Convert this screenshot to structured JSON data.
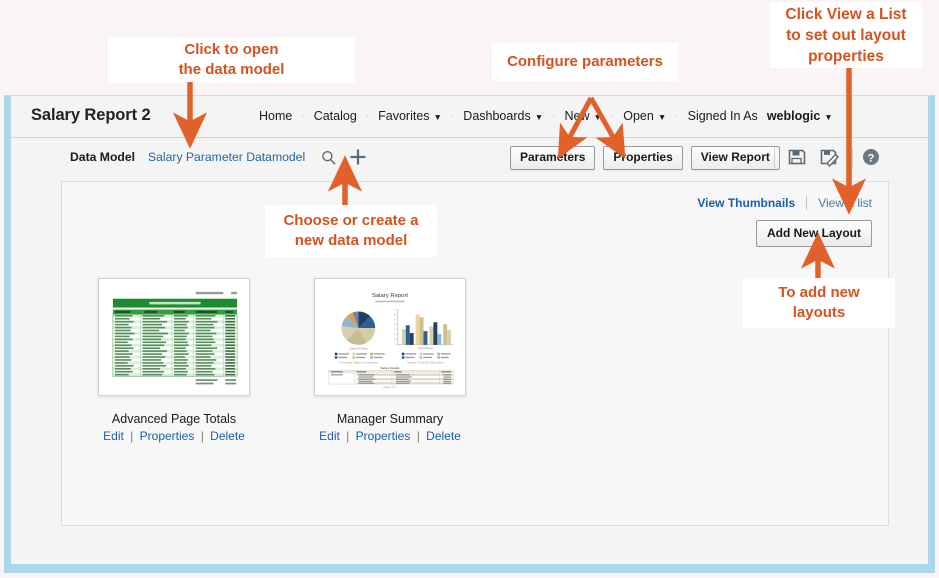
{
  "window": {
    "title": "Salary Report 2",
    "border_color": "#abd7ec",
    "background": "#f4f4f4"
  },
  "globalnav": {
    "items": [
      {
        "label": "Home",
        "caret": false
      },
      {
        "label": "Catalog",
        "caret": false
      },
      {
        "label": "Favorites",
        "caret": true
      },
      {
        "label": "Dashboards",
        "caret": true
      },
      {
        "label": "New",
        "caret": true
      },
      {
        "label": "Open",
        "caret": true
      }
    ],
    "signed_in_label": "Signed In As",
    "user": "weblogic",
    "user_caret": "▼",
    "separator": "·"
  },
  "toolbar": {
    "data_model_label": "Data Model",
    "data_model_value": "Salary Parameter Datamodel",
    "search_icon": "search-icon",
    "add_icon": "plus-icon",
    "buttons": [
      {
        "label": "Parameters",
        "name": "parameters-button"
      },
      {
        "label": "Properties",
        "name": "properties-button"
      },
      {
        "label": "View Report",
        "name": "view-report-button"
      }
    ],
    "save_icon": "save-icon",
    "save_as_icon": "save-as-icon",
    "help_icon": "help-icon"
  },
  "content": {
    "view_thumbnails_label": "View Thumbnails",
    "view_list_label": "View a list",
    "add_new_layout_label": "Add New Layout",
    "layouts": [
      {
        "title": "Advanced Page Totals",
        "links": [
          "Edit",
          "Properties",
          "Delete"
        ],
        "thumbnail_type": "table-report",
        "accent": "#1f8b2f"
      },
      {
        "title": "Manager Summary",
        "links": [
          "Edit",
          "Properties",
          "Delete"
        ],
        "thumbnail_type": "chart-report",
        "accent": "#c8a84b",
        "thumbnail_title": "Salary Report"
      }
    ],
    "link_separator": "|"
  },
  "annotations": [
    {
      "id": "a1",
      "text": "Click to open\nthe data model",
      "target": "data-model-link"
    },
    {
      "id": "a2",
      "text": "Configure parameters",
      "target": "parameters-and-properties-buttons"
    },
    {
      "id": "a3",
      "text": "Click View a List\nto set out layout\nproperties",
      "target": "view-a-list-link"
    },
    {
      "id": "a4",
      "text": "Choose or create a\nnew data model",
      "target": "add-data-model-icon"
    },
    {
      "id": "a5",
      "text": "To add new\nlayouts",
      "target": "add-new-layout-button"
    }
  ],
  "colors": {
    "annotation_text": "#d4531f",
    "annotation_arrow": "#e0622a",
    "link_blue": "#1c5fa8",
    "page_background": "#faf4f7"
  }
}
